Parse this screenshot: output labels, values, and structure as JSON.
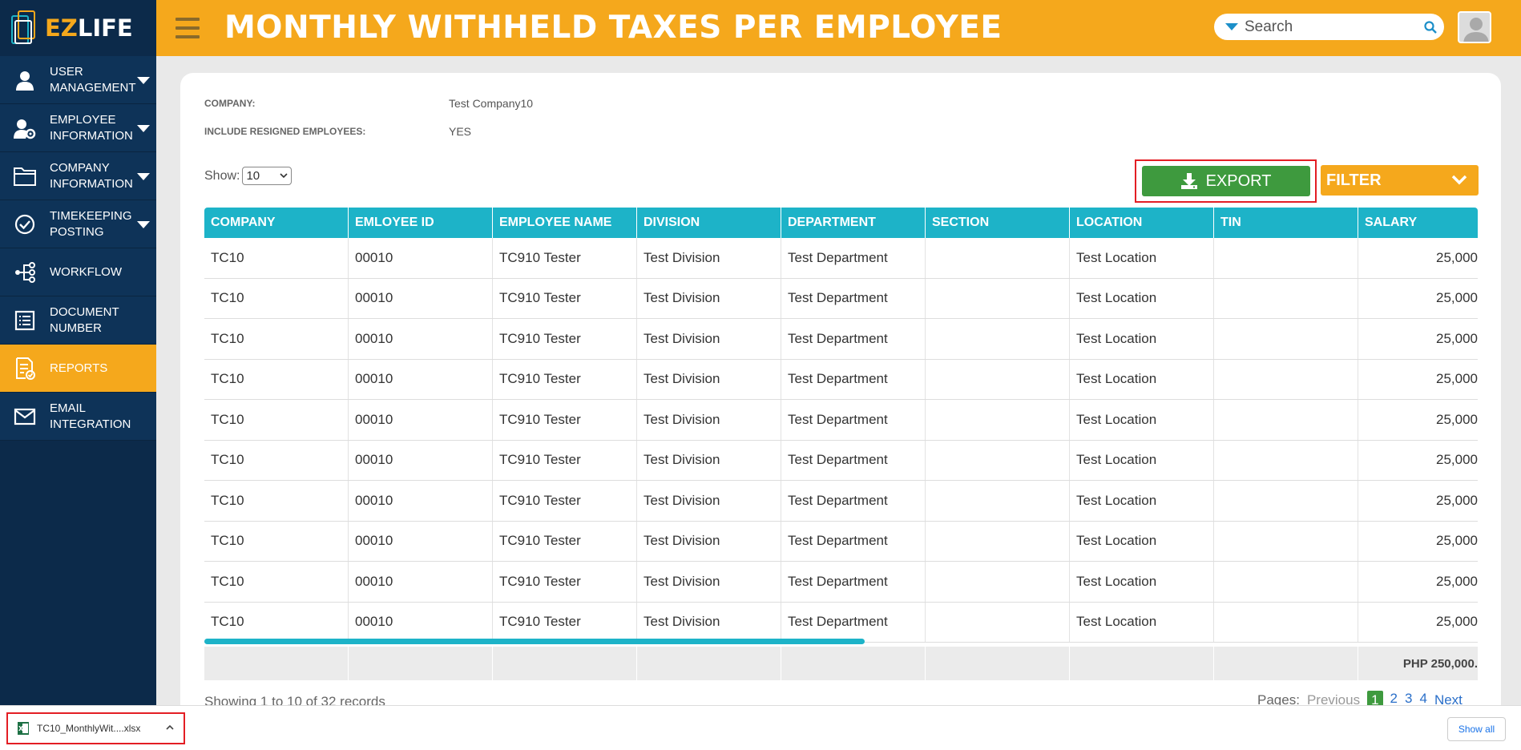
{
  "app": {
    "logo_ez": "EZ",
    "logo_life": "LIFE"
  },
  "sidebar": {
    "items": [
      {
        "label": "USER MANAGEMENT",
        "icon": "user-icon",
        "has_caret": true,
        "active": false
      },
      {
        "label": "EMPLOYEE INFORMATION",
        "icon": "user-gear-icon",
        "has_caret": true,
        "active": false
      },
      {
        "label": "COMPANY INFORMATION",
        "icon": "folder-icon",
        "has_caret": true,
        "active": false
      },
      {
        "label": "TIMEKEEPING POSTING",
        "icon": "check-circle-icon",
        "has_caret": true,
        "active": false
      },
      {
        "label": "WORKFLOW",
        "icon": "workflow-icon",
        "has_caret": false,
        "active": false
      },
      {
        "label": "DOCUMENT NUMBER",
        "icon": "document-list-icon",
        "has_caret": false,
        "active": false
      },
      {
        "label": "REPORTS",
        "icon": "report-check-icon",
        "has_caret": false,
        "active": true
      },
      {
        "label": "EMAIL INTEGRATION",
        "icon": "mail-icon",
        "has_caret": false,
        "active": false
      }
    ]
  },
  "header": {
    "title": "MONTHLY WITHHELD TAXES PER EMPLOYEE",
    "search_placeholder": "Search"
  },
  "report": {
    "company_label": "COMPANY:",
    "company_value": "Test Company10",
    "resigned_label": "INCLUDE RESIGNED EMPLOYEES:",
    "resigned_value": "YES",
    "show_label": "Show:",
    "show_value": "10",
    "export_label": "EXPORT",
    "filter_label": "FILTER"
  },
  "table": {
    "columns": [
      "COMPANY",
      "EMLOYEE ID",
      "EMPLOYEE NAME",
      "DIVISION",
      "DEPARTMENT",
      "SECTION",
      "LOCATION",
      "TIN",
      "SALARY"
    ],
    "rows": [
      [
        "TC10",
        "00010",
        "TC910 Tester",
        "Test Division",
        "Test Department",
        "",
        "Test Location",
        "",
        "25,000"
      ],
      [
        "TC10",
        "00010",
        "TC910 Tester",
        "Test Division",
        "Test Department",
        "",
        "Test Location",
        "",
        "25,000"
      ],
      [
        "TC10",
        "00010",
        "TC910 Tester",
        "Test Division",
        "Test Department",
        "",
        "Test Location",
        "",
        "25,000"
      ],
      [
        "TC10",
        "00010",
        "TC910 Tester",
        "Test Division",
        "Test Department",
        "",
        "Test Location",
        "",
        "25,000"
      ],
      [
        "TC10",
        "00010",
        "TC910 Tester",
        "Test Division",
        "Test Department",
        "",
        "Test Location",
        "",
        "25,000"
      ],
      [
        "TC10",
        "00010",
        "TC910 Tester",
        "Test Division",
        "Test Department",
        "",
        "Test Location",
        "",
        "25,000"
      ],
      [
        "TC10",
        "00010",
        "TC910 Tester",
        "Test Division",
        "Test Department",
        "",
        "Test Location",
        "",
        "25,000"
      ],
      [
        "TC10",
        "00010",
        "TC910 Tester",
        "Test Division",
        "Test Department",
        "",
        "Test Location",
        "",
        "25,000"
      ],
      [
        "TC10",
        "00010",
        "TC910 Tester",
        "Test Division",
        "Test Department",
        "",
        "Test Location",
        "",
        "25,000"
      ],
      [
        "TC10",
        "00010",
        "TC910 Tester",
        "Test Division",
        "Test Department",
        "",
        "Test Location",
        "",
        "25,000"
      ]
    ],
    "total_salary": "PHP 250,000.",
    "records_text": "Showing 1 to 10 of 32 records",
    "pages_label": "Pages:",
    "previous_label": "Previous",
    "pages": [
      "1",
      "2",
      "3",
      "4"
    ],
    "current_page": "1",
    "next_label": "Next"
  },
  "download": {
    "filename": "TC10_MonthlyWit....xlsx",
    "show_all": "Show all"
  },
  "colors": {
    "sidebar_bg": "#0c2a4a",
    "accent_orange": "#f5a81c",
    "table_header": "#1db3c8",
    "export_green": "#3e9a3e",
    "highlight_red": "#e31e24"
  }
}
